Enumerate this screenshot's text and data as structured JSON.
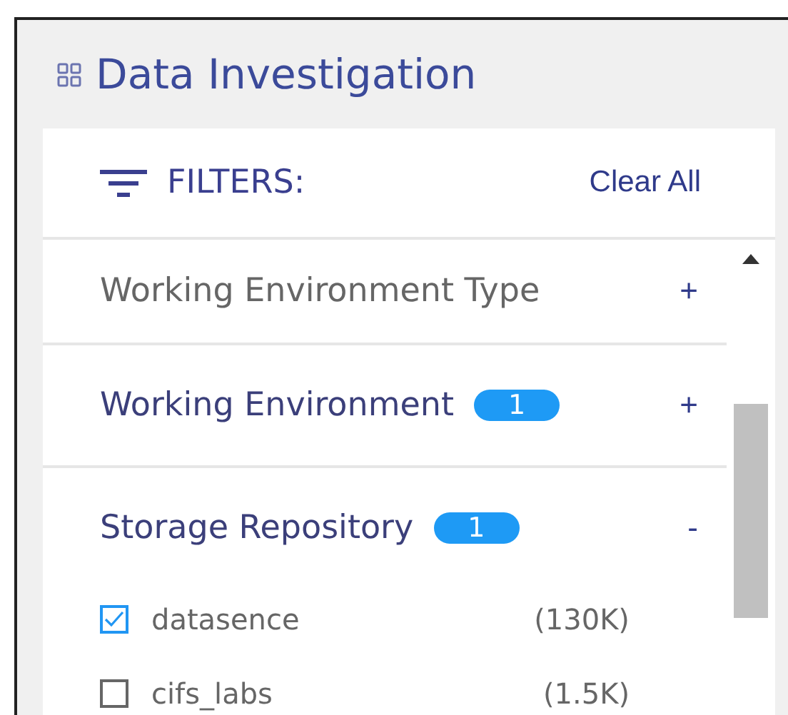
{
  "panel": {
    "title": "Data Investigation"
  },
  "filters": {
    "title": "FILTERS:",
    "clear_all": "Clear All",
    "groups": [
      {
        "label": "Working Environment Type",
        "toggle": "+"
      },
      {
        "label": "Working Environment",
        "count": "1",
        "toggle": "+"
      },
      {
        "label": "Storage Repository",
        "count": "1",
        "toggle": "-",
        "options": [
          {
            "label": "datasence",
            "count": "(130K)",
            "checked": true
          },
          {
            "label": "cifs_labs",
            "count": "(1.5K)",
            "checked": false
          }
        ]
      }
    ]
  }
}
